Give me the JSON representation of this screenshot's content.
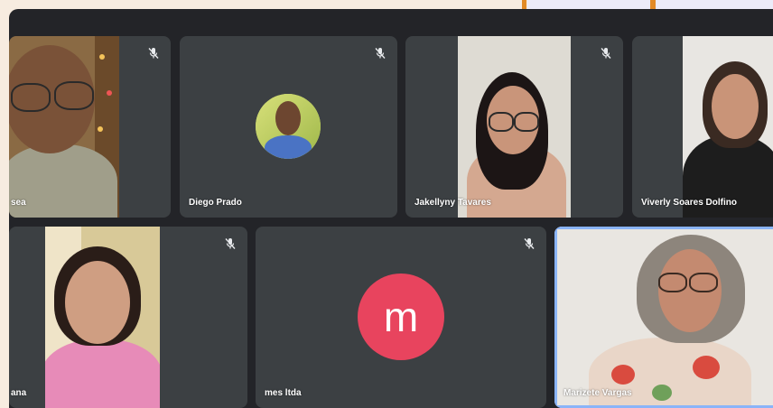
{
  "participants": [
    {
      "name": "sea",
      "muted": true,
      "type": "video"
    },
    {
      "name": "Diego Prado",
      "muted": true,
      "type": "photo"
    },
    {
      "name": "Jakellyny Tavares",
      "muted": true,
      "type": "video"
    },
    {
      "name": "Viverly Soares Dolfino",
      "muted": false,
      "type": "video"
    },
    {
      "name": "ana",
      "muted": true,
      "type": "video"
    },
    {
      "name": "mes ltda",
      "muted": true,
      "type": "initial",
      "initial": "m",
      "avatar_color": "#e8445e"
    },
    {
      "name": "Marizete Vargas",
      "muted": false,
      "type": "video",
      "speaking": true
    }
  ],
  "colors": {
    "background": "#232428",
    "tile": "#3c4043",
    "speaking_border": "#8ab4f8",
    "accent_orange": "#e28a25"
  },
  "icons": {
    "mute": "mic-off-icon"
  }
}
